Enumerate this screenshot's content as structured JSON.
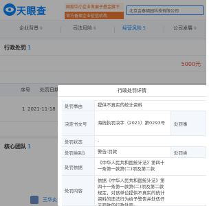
{
  "header": {
    "brand": "天眼查",
    "promo_line1": "国家中小企业发展子基金旗下",
    "promo_line2": "官方备案企业征信机构",
    "search_value": "北京金泰國园科技有限公司"
  },
  "nav": {
    "items": [
      {
        "label": "企业背景",
        "count": "9"
      },
      {
        "label": "司法风险",
        "count": "6"
      },
      {
        "label": "经营风险",
        "count": "5"
      },
      {
        "label": "公司发展",
        "count": "9"
      }
    ]
  },
  "penalty": {
    "title": "行政处罚",
    "count": "1",
    "amount": "5000元",
    "columns": [
      "序号",
      "处罚日期"
    ],
    "rows": [
      {
        "index": "1",
        "date": "2021-11-18"
      }
    ]
  },
  "core_team": {
    "title": "核心团队",
    "count": "1",
    "person": "王华炎"
  },
  "modal": {
    "title": "行政处罚详情",
    "rows": [
      {
        "label": "处罚事由",
        "value": "提供不真实的统计资料",
        "right_label": ""
      },
      {
        "label": "决定书文号",
        "value": "海统执罚决字（2021）第0293号",
        "right_label": "处罚事"
      },
      {
        "label": "处罚状态",
        "value": "-",
        "right_label": ""
      },
      {
        "label": "处罚类别1",
        "value": "警告;罚款",
        "right_label": "处罚类"
      },
      {
        "label": "处罚依据",
        "value": "《中华人民共和国统计法》第四十一条第一款第(二)项及第二款",
        "right_label": ""
      },
      {
        "label": "处罚内容",
        "value": "依据《中华人民共和国统计法》第四十一条第一款第(二)项及第二款规定，对该单位提供不真实的统计资料的违法行为给予警告并处伍仟元罚款的行政处罚。",
        "right_label": ""
      }
    ]
  },
  "colors": {
    "accent": "#0a84ff",
    "amount": "#e14b3b",
    "promo": "#f07a32"
  }
}
